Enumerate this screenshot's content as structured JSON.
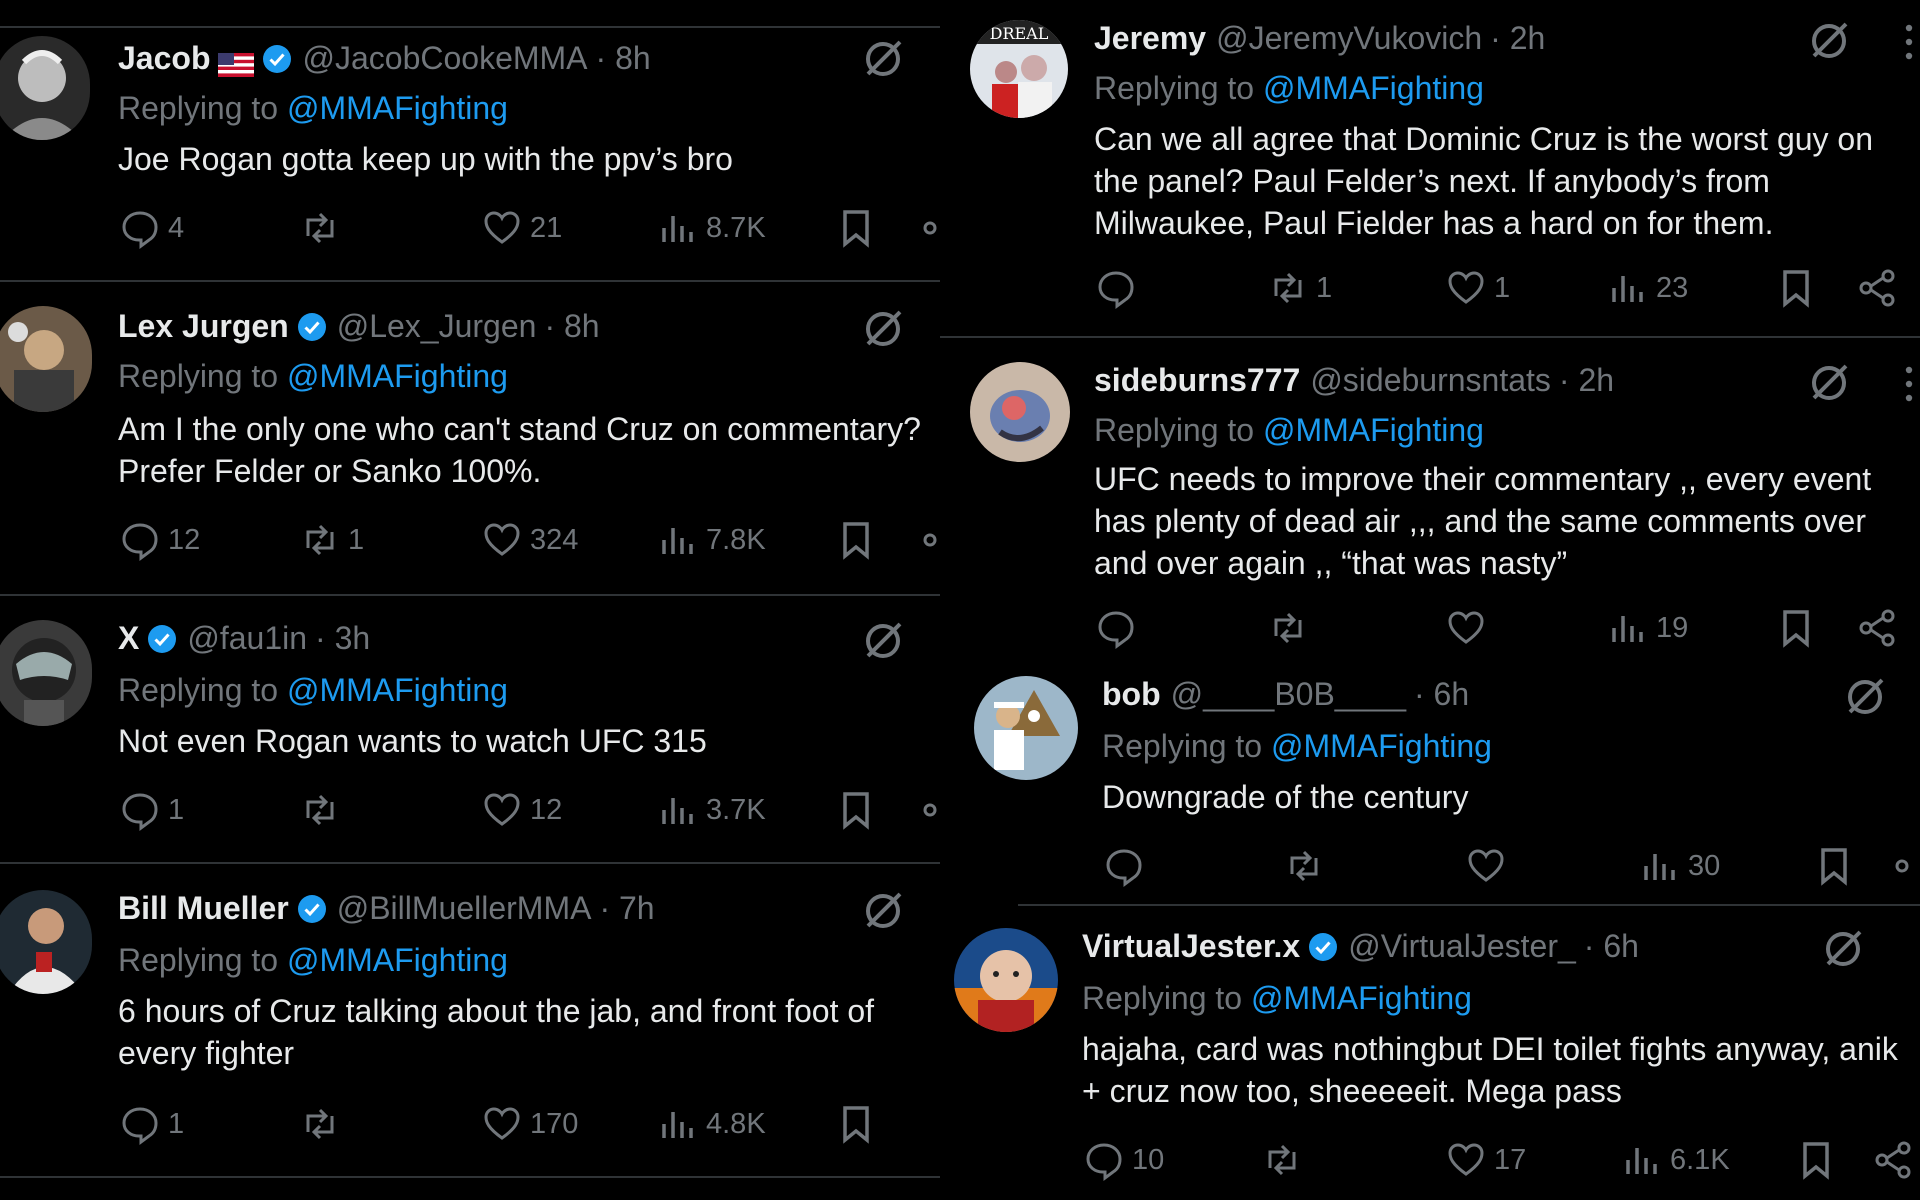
{
  "mention": "@MMAFighting",
  "replying_prefix": "Replying to",
  "left": [
    {
      "name": "Jacob",
      "verified": true,
      "flag": true,
      "handle": "@JacobCookeMMA",
      "time": "· 8h",
      "text": "Joe Rogan gotta keep up with the ppv’s bro",
      "replies": "4",
      "reposts": "",
      "likes": "21",
      "views": "8.7K"
    },
    {
      "name": "Lex Jurgen",
      "verified": true,
      "handle": "@Lex_Jurgen",
      "time": "· 8h",
      "text": "Am I the only one who can't stand Cruz on commentary? Prefer Felder or Sanko 100%.",
      "replies": "12",
      "reposts": "1",
      "likes": "324",
      "views": "7.8K"
    },
    {
      "name": "X",
      "verified": true,
      "handle": "@fau1in",
      "time": "· 3h",
      "text": "Not even Rogan wants to watch UFC 315",
      "replies": "1",
      "reposts": "",
      "likes": "12",
      "views": "3.7K"
    },
    {
      "name": "Bill Mueller",
      "verified": true,
      "handle": "@BillMuellerMMA",
      "time": "· 7h",
      "text": "6 hours of Cruz talking about the jab, and front foot of every fighter",
      "replies": "1",
      "reposts": "",
      "likes": "170",
      "views": "4.8K"
    }
  ],
  "right": [
    {
      "name": "Jeremy",
      "verified": false,
      "handle": "@JeremyVukovich",
      "time": "· 2h",
      "text": "Can we all agree that Dominic Cruz is the worst guy on the panel? Paul Felder’s next. If anybody’s from Milwaukee, Paul Fielder has a hard on for them.",
      "replies": "",
      "reposts": "1",
      "likes": "1",
      "views": "23",
      "avatar_text": "DREAL"
    },
    {
      "name": "sideburns777",
      "verified": false,
      "handle": "@sideburnsntats",
      "time": "· 2h",
      "text": "UFC needs to improve their commentary ,, every event has plenty of dead air ,,, and the same comments over and over again ,, “that was nasty”",
      "replies": "",
      "reposts": "",
      "likes": "",
      "views": "19"
    },
    {
      "name": "bob",
      "verified": false,
      "handle": "@____B0B____",
      "time": "· 6h",
      "text": "Downgrade of the century",
      "replies": "",
      "reposts": "",
      "likes": "",
      "views": "30"
    },
    {
      "name": "VirtualJester.x",
      "verified": true,
      "handle": "@VirtualJester_",
      "time": "· 6h",
      "text": "hajaha, card was nothingbut DEI toilet fights anyway, anik + cruz now too, sheeeeeit. Mega pass",
      "replies": "10",
      "reposts": "",
      "likes": "17",
      "views": "6.1K"
    }
  ],
  "icons": {
    "reply": "reply-icon",
    "repost": "repost-icon",
    "like": "like-icon",
    "views": "views-icon",
    "bookmark": "bookmark-icon",
    "share": "share-icon",
    "grok": "grok-icon",
    "verified": "verified-badge-icon"
  },
  "colors": {
    "background": "#000000",
    "text": "#e7e9ea",
    "muted": "#71767b",
    "accent": "#1d9bf0",
    "divider": "#2f3336"
  }
}
